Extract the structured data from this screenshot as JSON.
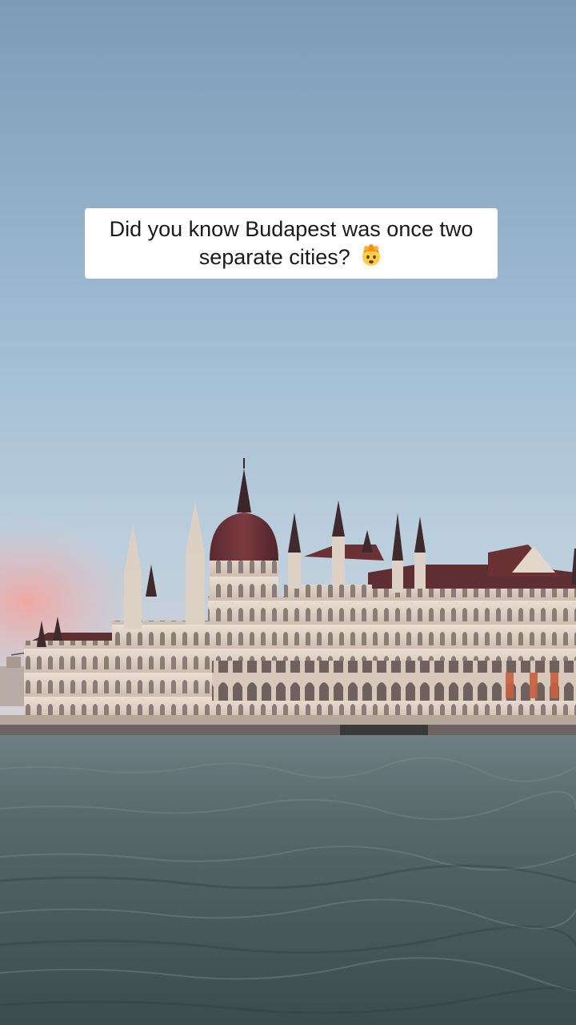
{
  "caption": {
    "line1": "Did you know Budapest was once two",
    "line2": "separate cities?",
    "emoji": "exploding-head-emoji"
  },
  "scene": {
    "subject": "hungarian-parliament-building",
    "colors": {
      "sky_top": "#7e9bba",
      "sky_mid": "#aac3d8",
      "sunset_pink": "#f2a9a3",
      "facade": "#e6d8cd",
      "roof": "#6b3236",
      "river": "#4d5e5f"
    }
  }
}
